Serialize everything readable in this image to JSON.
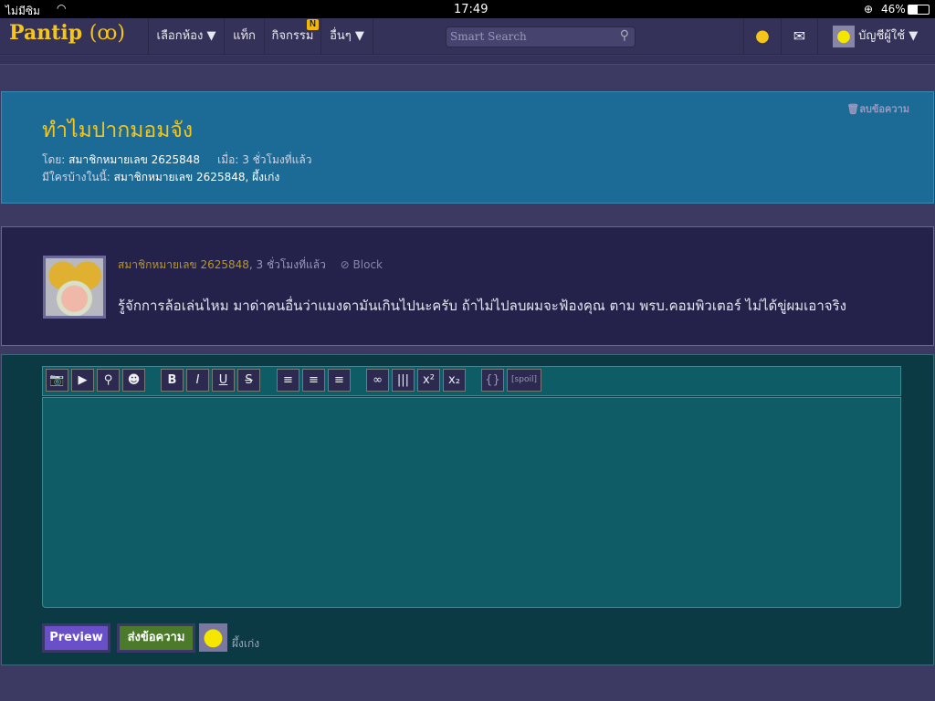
{
  "status": {
    "carrier": "ไม่มีซิม",
    "time": "17:49",
    "battery": "46%"
  },
  "nav": {
    "logo": "Pantip",
    "items": [
      {
        "label": "เลือกห้อง ▼"
      },
      {
        "label": "แท็ก"
      },
      {
        "label": "กิจกรรม",
        "badge": "N"
      },
      {
        "label": "อื่นๆ ▼"
      }
    ],
    "search_placeholder": "Smart Search",
    "account": "บัญชีผู้ใช้ ▼"
  },
  "topic": {
    "delete": "ลบข้อความ",
    "title": "ทำไมปากมอมจัง",
    "by_label": "โดย:",
    "author": "สมาชิกหมายเลข 2625848",
    "when_label": "เมื่อ:",
    "when": "3 ชั่วโมงที่แล้ว",
    "who_label": "มีใครบ้างในนี้:",
    "who": "สมาชิกหมายเลข 2625848, ผึ้งเก่ง"
  },
  "comment": {
    "author": "สมาชิกหมายเลข 2625848",
    "time": ", 3 ชั่วโมงที่แล้ว",
    "block": "Block",
    "body": "รู้จักการล้อเล่นไหม มาด่าคนอื่นว่าแมงดามันเกินไปนะครับ ถ้าไม่ไปลบผมจะฟ้องคุณ ตาม พรบ.คอมพิวเตอร์ ไม่ได้ขู่ผมเอาจริง"
  },
  "editor": {
    "tools": [
      {
        "name": "image-icon",
        "g": "📷"
      },
      {
        "name": "video-icon",
        "g": "▶"
      },
      {
        "name": "map-pin-icon",
        "g": "⚲"
      },
      {
        "name": "emoticon-icon",
        "g": "☻"
      },
      {
        "name": "bold-icon",
        "g": "B"
      },
      {
        "name": "italic-icon",
        "g": "I"
      },
      {
        "name": "underline-icon",
        "g": "U"
      },
      {
        "name": "strikethrough-icon",
        "g": "S"
      },
      {
        "name": "align-left-icon",
        "g": "≡"
      },
      {
        "name": "align-center-icon",
        "g": "≡"
      },
      {
        "name": "align-right-icon",
        "g": "≡"
      },
      {
        "name": "link-icon",
        "g": "∞"
      },
      {
        "name": "barcode-icon",
        "g": "|||"
      },
      {
        "name": "superscript-icon",
        "g": "x²"
      },
      {
        "name": "subscript-icon",
        "g": "x₂"
      },
      {
        "name": "code-icon",
        "g": "{}"
      },
      {
        "name": "spoiler-icon",
        "g": "[spoil]"
      }
    ],
    "preview": "Preview",
    "submit": "ส่งข้อความ",
    "username": "ผึ้งเก่ง"
  }
}
